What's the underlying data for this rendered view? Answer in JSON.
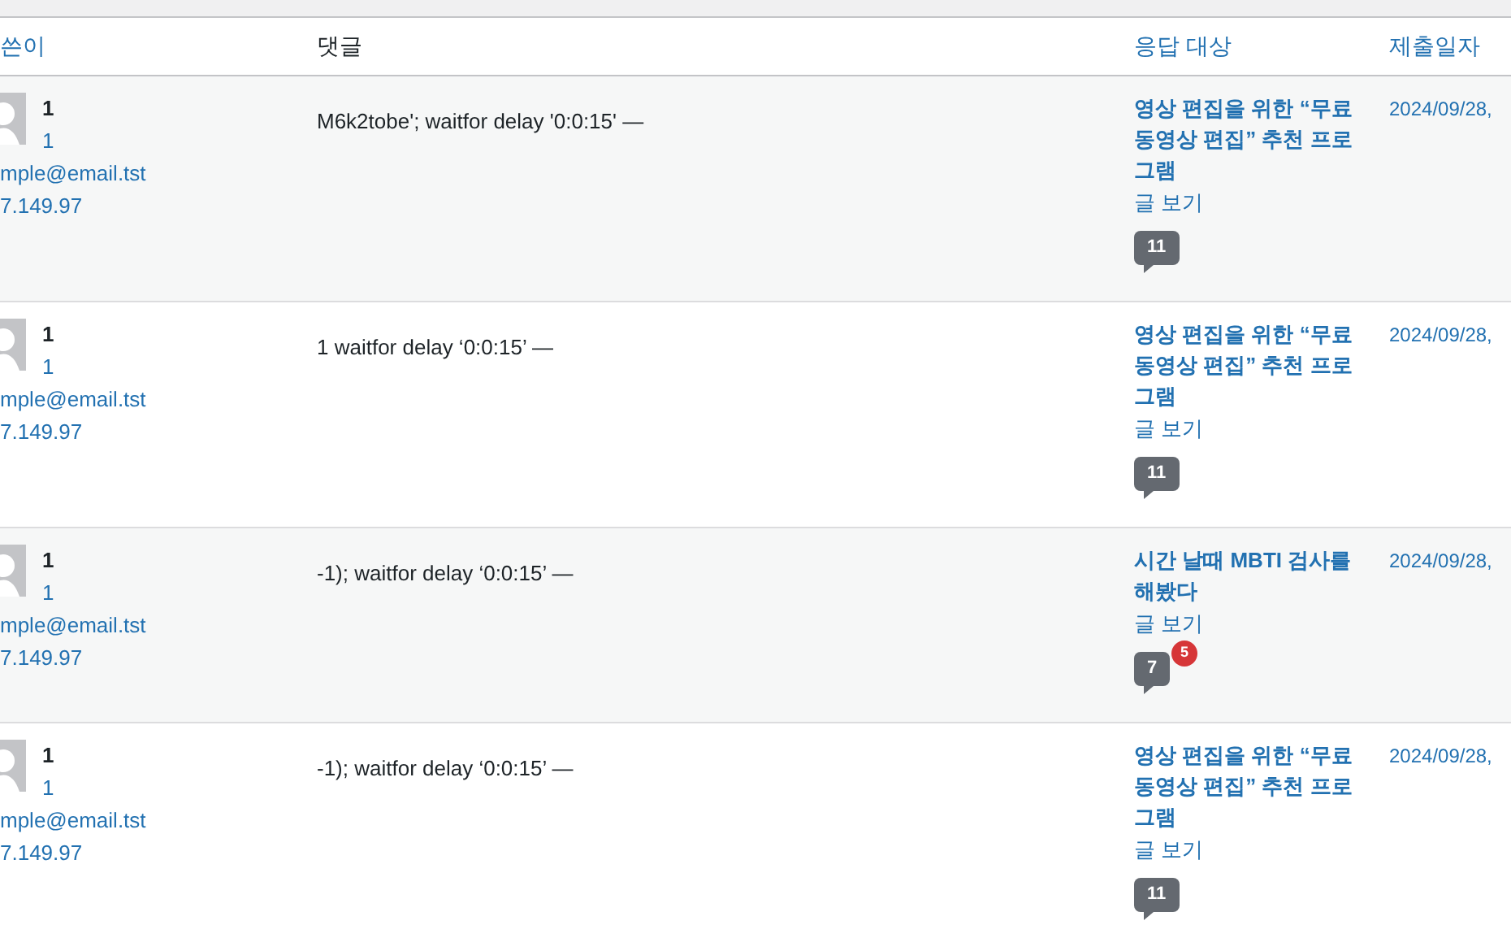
{
  "table": {
    "columns": [
      {
        "label": "쓴이"
      },
      {
        "label": "댓글"
      },
      {
        "label": "응답 대상"
      },
      {
        "label": "제출일자"
      }
    ],
    "rows": [
      {
        "author_name": "1",
        "author_url": "1",
        "email": "mple@email.tst",
        "ip": "7.149.97",
        "comment": "M6k2tobe'; waitfor delay '0:0:15' —",
        "post_title": "영상 편집을 위한 “무료 동영상 편집” 추천 프로그램",
        "view_link": "글 보기",
        "comment_count": "11",
        "date": "2024/09/28,"
      },
      {
        "author_name": "1",
        "author_url": "1",
        "email": "mple@email.tst",
        "ip": "7.149.97",
        "comment": "1 waitfor delay ‘0:0:15’ —",
        "post_title": "영상 편집을 위한 “무료 동영상 편집” 추천 프로그램",
        "view_link": "글 보기",
        "comment_count": "11",
        "date": "2024/09/28,"
      },
      {
        "author_name": "1",
        "author_url": "1",
        "email": "mple@email.tst",
        "ip": "7.149.97",
        "comment": "-1); waitfor delay ‘0:0:15’ —",
        "post_title": "시간 날때 MBTI 검사를 해봤다",
        "view_link": "글 보기",
        "comment_count": "7",
        "pending_count": "5",
        "date": "2024/09/28,"
      },
      {
        "author_name": "1",
        "author_url": "1",
        "email": "mple@email.tst",
        "ip": "7.149.97",
        "comment": "-1); waitfor delay ‘0:0:15’ —",
        "post_title": "영상 편집을 위한 “무료 동영상 편집” 추천 프로그램",
        "view_link": "글 보기",
        "comment_count": "11",
        "date": "2024/09/28,"
      }
    ]
  }
}
